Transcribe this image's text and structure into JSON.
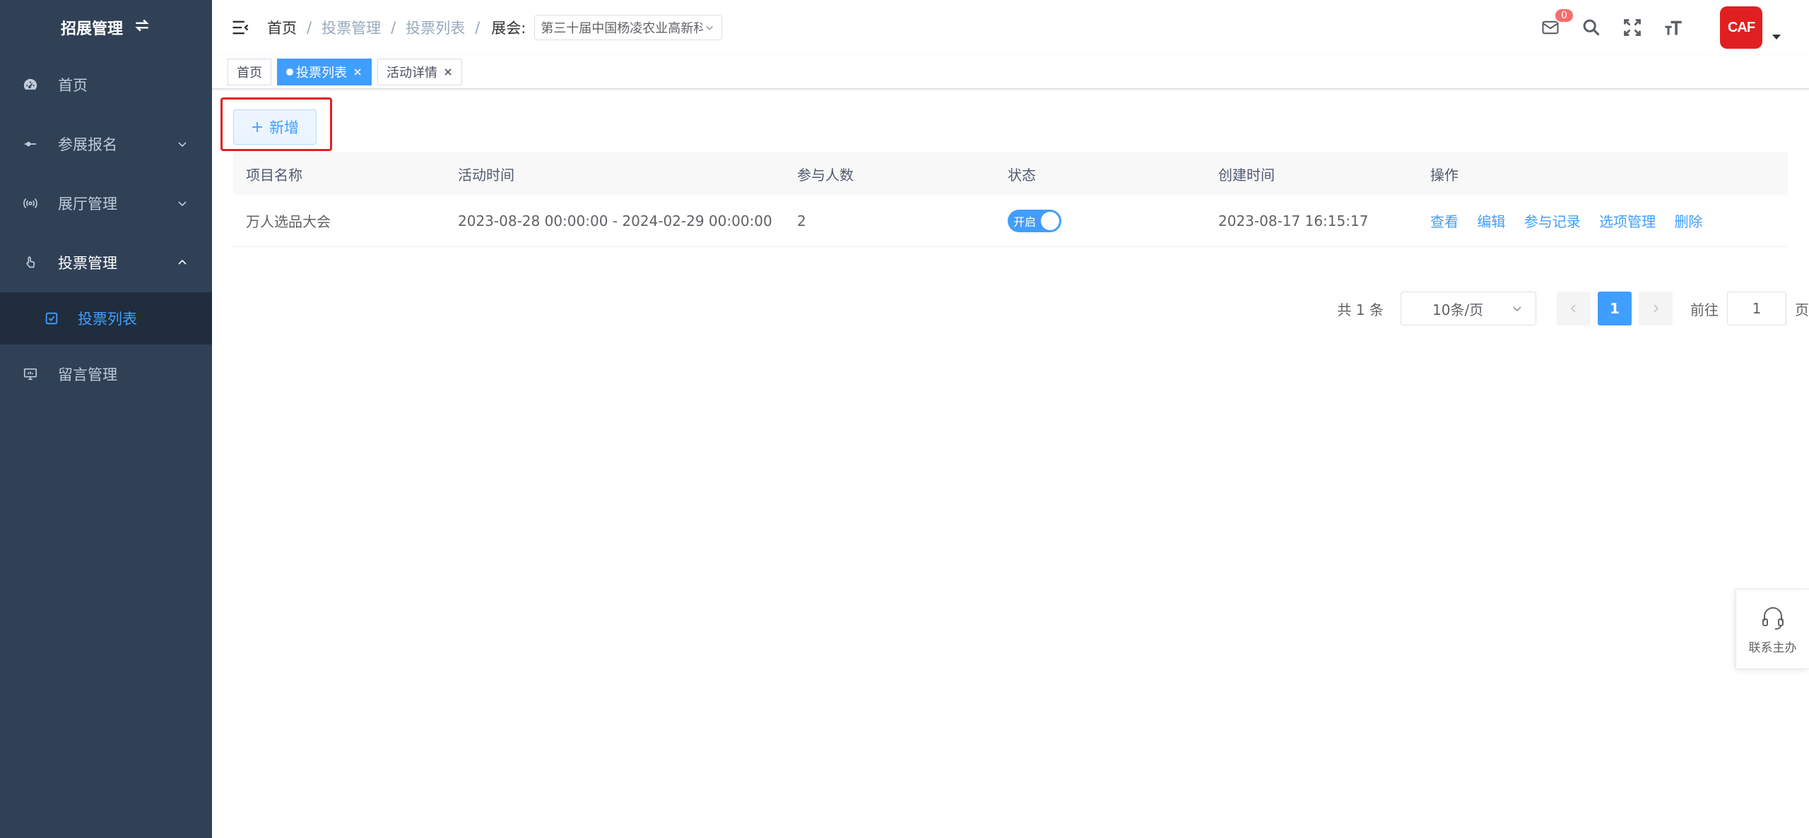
{
  "sidebar": {
    "title": "招展管理",
    "items": [
      {
        "label": "首页"
      },
      {
        "label": "参展报名"
      },
      {
        "label": "展厅管理"
      },
      {
        "label": "投票管理"
      },
      {
        "label": "投票列表"
      },
      {
        "label": "留言管理"
      }
    ]
  },
  "header": {
    "breadcrumb": [
      "首页",
      "投票管理",
      "投票列表"
    ],
    "expo_label": "展会:",
    "expo_value": "第三十届中国杨凌农业高新科技成果博览会",
    "notification_count": "0",
    "avatar_text": "CAF"
  },
  "tags": [
    {
      "label": "首页"
    },
    {
      "label": "投票列表"
    },
    {
      "label": "活动详情"
    }
  ],
  "toolbar": {
    "add_label": "新增"
  },
  "table": {
    "headers": [
      "项目名称",
      "活动时间",
      "参与人数",
      "状态",
      "创建时间",
      "操作"
    ],
    "rows": [
      {
        "name": "万人选品大会",
        "time": "2023-08-28 00:00:00 - 2024-02-29 00:00:00",
        "count": "2",
        "status": "开启",
        "created": "2023-08-17 16:15:17",
        "ops": [
          "查看",
          "编辑",
          "参与记录",
          "选项管理",
          "删除"
        ]
      }
    ]
  },
  "pagination": {
    "total": "共 1 条",
    "page_size": "10条/页",
    "current": "1",
    "goto_label": "前往",
    "goto_value": "1",
    "page_unit": "页"
  },
  "contact": {
    "label": "联系主办"
  },
  "colors": {
    "sidebar_bg": "#304156",
    "accent": "#409eff",
    "highlight": "#e02020"
  }
}
